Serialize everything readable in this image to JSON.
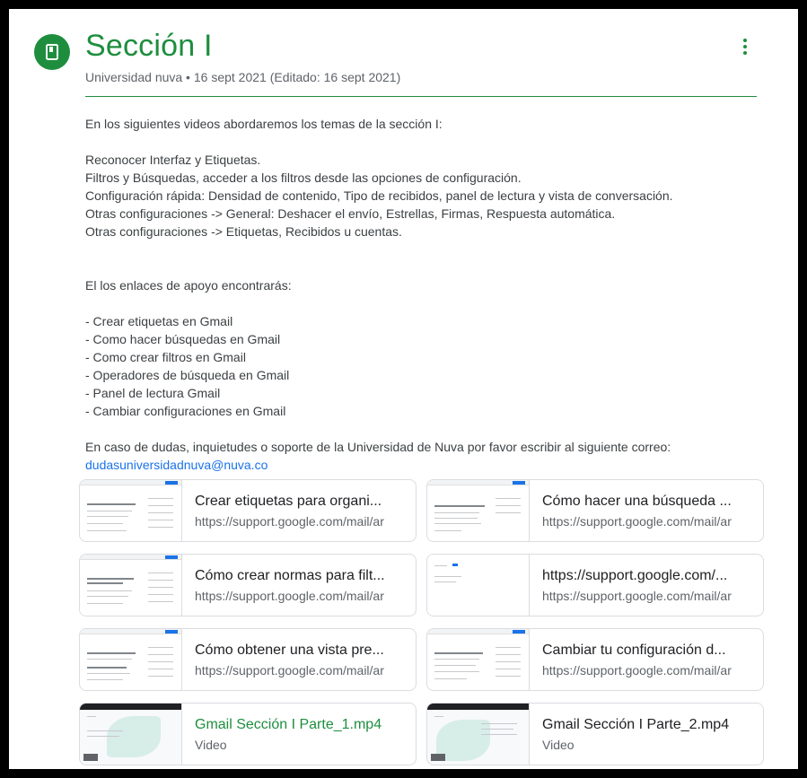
{
  "header": {
    "title": "Sección I",
    "meta": "Universidad nuva • 16 sept 2021 (Editado: 16 sept 2021)"
  },
  "icons": {
    "section": "book-icon",
    "menu": "more-vert-icon"
  },
  "colors": {
    "accent": "#1e8e3e",
    "link": "#1a73e8",
    "text": "#3c4043",
    "muted": "#5f6368"
  },
  "body": {
    "intro": "En los siguientes videos abordaremos los temas de la sección I:",
    "topics": [
      "Reconocer Interfaz y Etiquetas.",
      "Filtros y Búsquedas, acceder a los filtros desde las opciones de configuración.",
      "Configuración rápida: Densidad de contenido, Tipo de recibidos, panel de lectura y vista de conversación.",
      "Otras configuraciones -> General: Deshacer el envío, Estrellas, Firmas, Respuesta automática.",
      "Otras configuraciones -> Etiquetas, Recibidos u cuentas."
    ],
    "links_intro": "El los enlaces de apoyo encontrarás:",
    "links": [
      "- Crear etiquetas en Gmail",
      "- Como hacer búsquedas en Gmail",
      "- Como crear filtros en Gmail",
      "- Operadores de búsqueda en Gmail",
      "- Panel de lectura Gmail",
      "- Cambiar configuraciones en Gmail"
    ],
    "contact": "En caso de dudas, inquietudes o soporte de la Universidad de Nuva por favor escribir al siguiente correo:",
    "email": "dudasuniversidadnuva@nuva.co"
  },
  "attachments": [
    {
      "title": "Crear etiquetas para organi...",
      "subtitle": "https://support.google.com/mail/ar"
    },
    {
      "title": "Cómo hacer una búsqueda ...",
      "subtitle": "https://support.google.com/mail/ar"
    },
    {
      "title": "Cómo crear normas para filt...",
      "subtitle": "https://support.google.com/mail/ar"
    },
    {
      "title": "https://support.google.com/...",
      "subtitle": "https://support.google.com/mail/ar"
    },
    {
      "title": "Cómo obtener una vista pre...",
      "subtitle": "https://support.google.com/mail/ar"
    },
    {
      "title": "Cambiar tu configuración d...",
      "subtitle": "https://support.google.com/mail/ar"
    },
    {
      "title": "Gmail Sección I Parte_1.mp4",
      "subtitle": "Video"
    },
    {
      "title": "Gmail Sección I Parte_2.mp4",
      "subtitle": "Video"
    }
  ]
}
